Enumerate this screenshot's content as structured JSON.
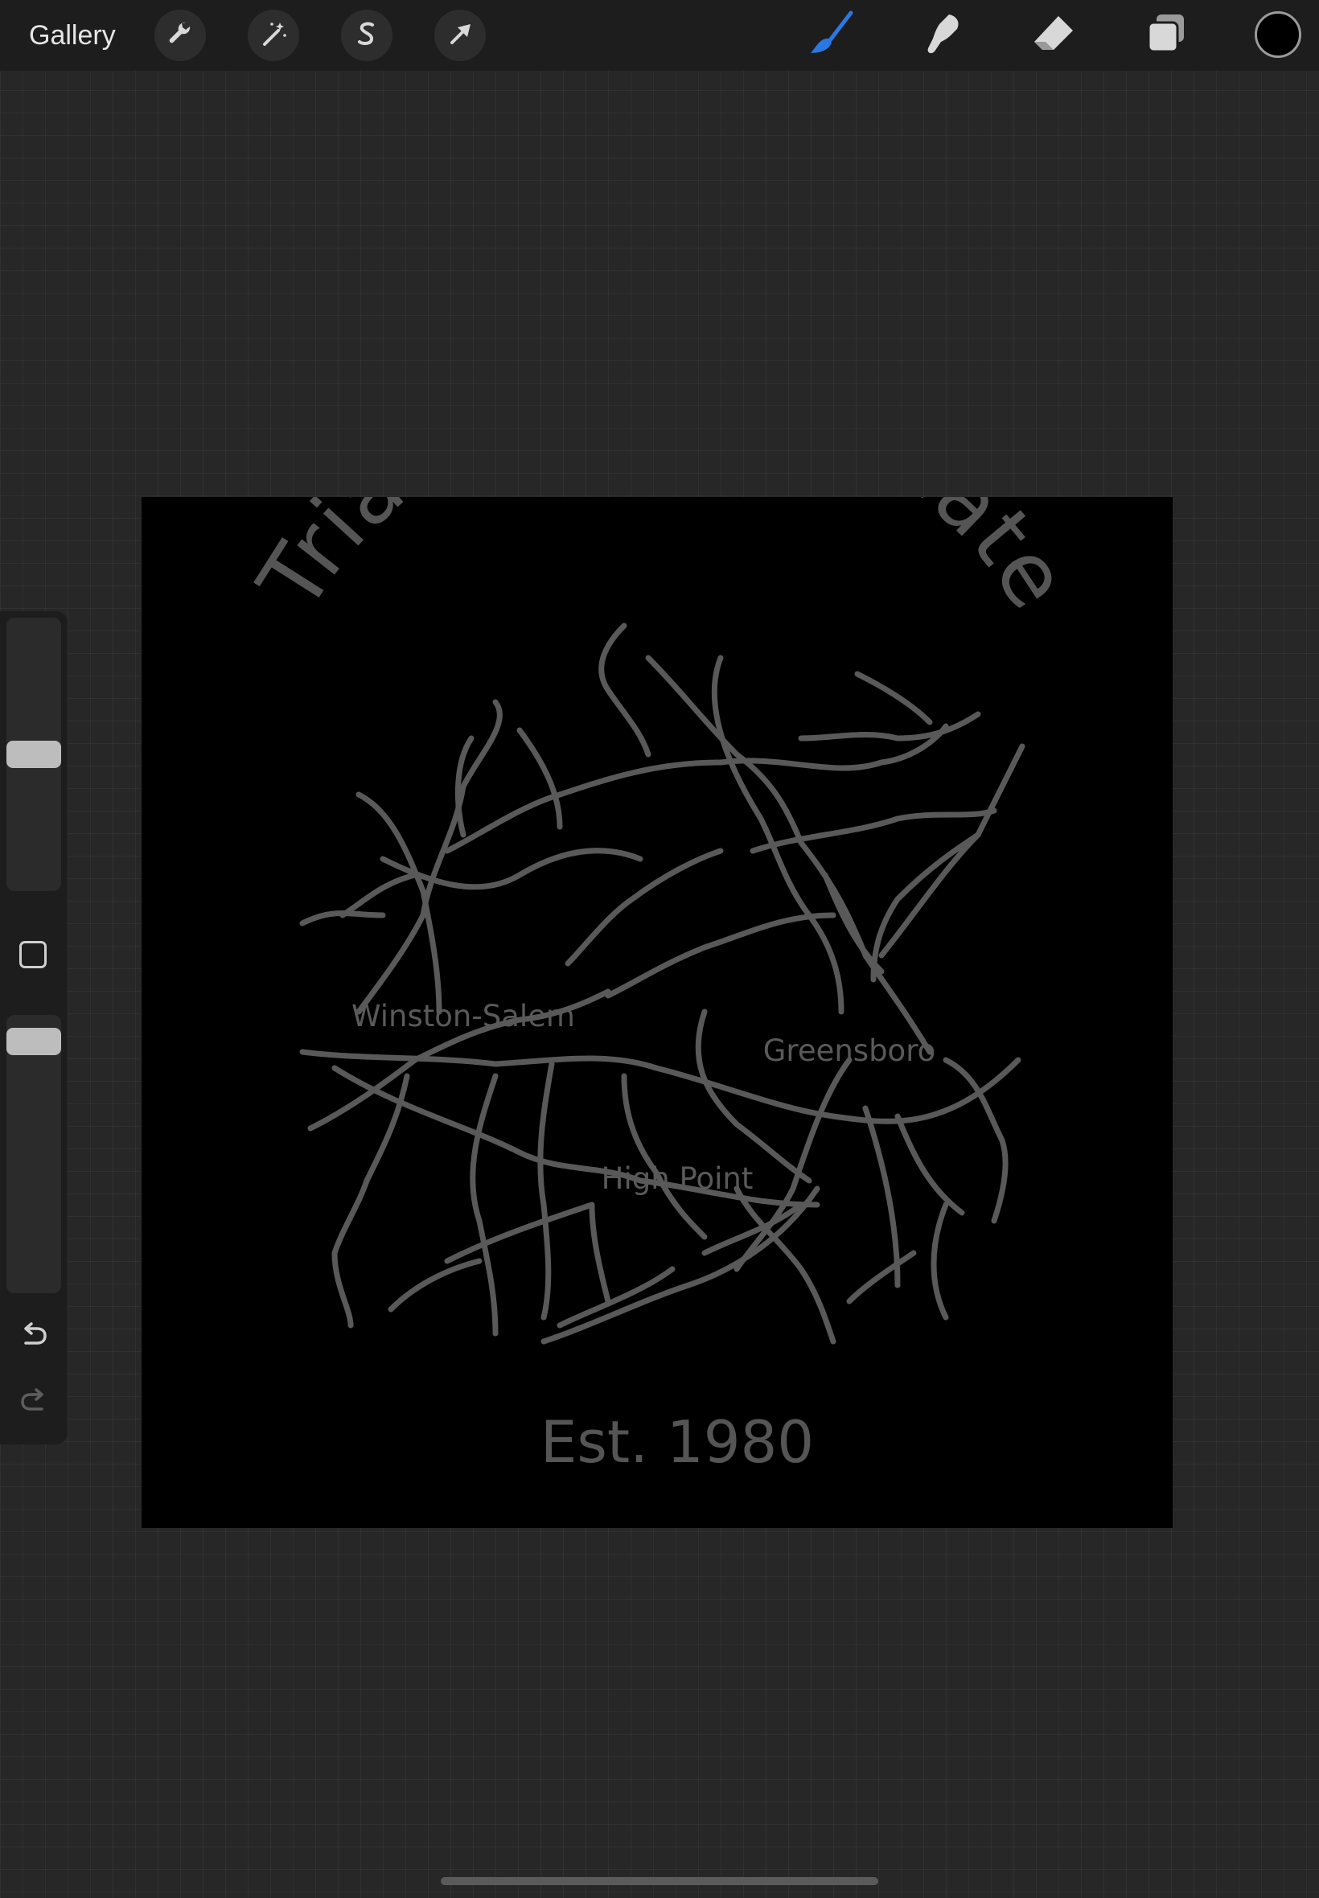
{
  "toolbar": {
    "gallery_label": "Gallery",
    "left_tools": [
      {
        "name": "actions",
        "icon": "wrench-icon"
      },
      {
        "name": "adjustments",
        "icon": "magic-wand-icon"
      },
      {
        "name": "selection",
        "icon": "selection-s-icon"
      },
      {
        "name": "transform",
        "icon": "arrow-cursor-icon"
      }
    ],
    "right_tools": [
      {
        "name": "brush",
        "icon": "brush-icon",
        "active": true
      },
      {
        "name": "smudge",
        "icon": "smudge-icon"
      },
      {
        "name": "eraser",
        "icon": "eraser-icon"
      },
      {
        "name": "layers",
        "icon": "layers-icon"
      }
    ],
    "current_color": "#000000",
    "active_tool_color": "#2a78e4"
  },
  "sidebar": {
    "size_slider_level": 0.5,
    "opacity_slider_level": 0.95,
    "undo_icon": "undo-icon",
    "redo_icon": "redo-icon"
  },
  "artwork": {
    "title": "Triad Area Ultimate",
    "cities": [
      "Winston-Salem",
      "Greensboro",
      "High Point"
    ],
    "established": "Est. 1980",
    "ink_color": "#5a5a5a",
    "background_color": "#000000"
  }
}
